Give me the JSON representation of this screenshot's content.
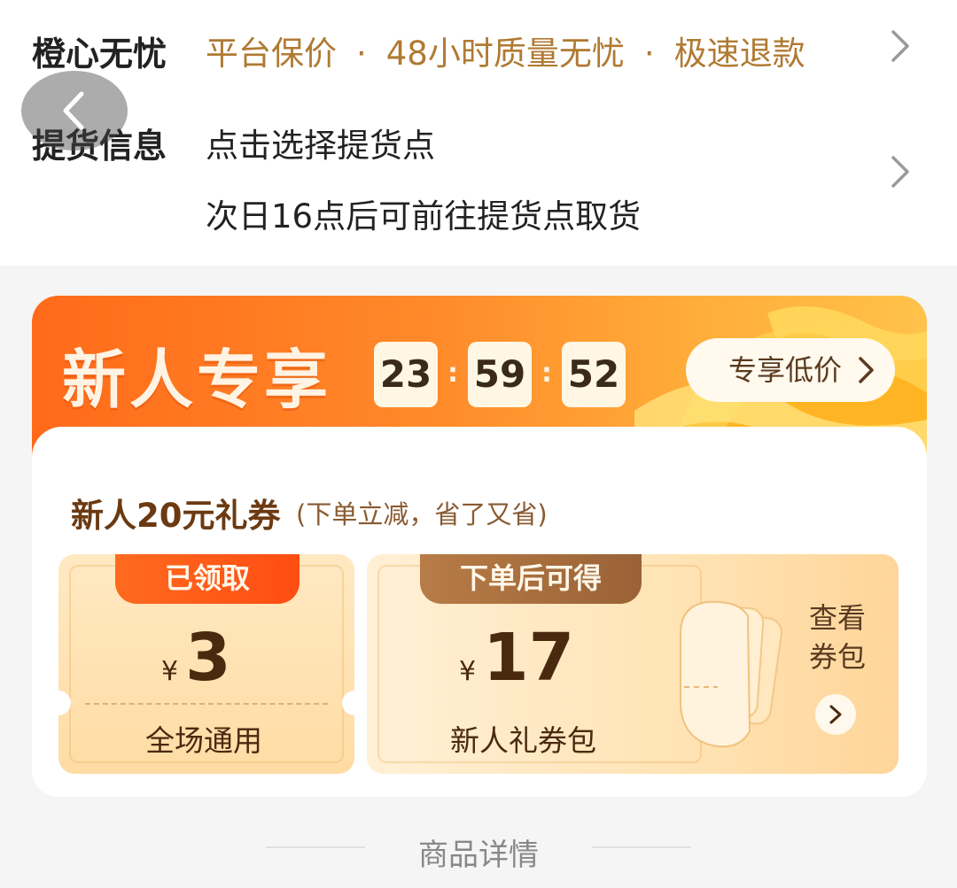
{
  "service": {
    "label": "橙心无忧",
    "items": [
      "平台保价",
      "48小时质量无忧",
      "极速退款"
    ],
    "separator": "·"
  },
  "pickup": {
    "label": "提货信息",
    "select_point": "点击选择提货点",
    "pickup_time": "次日16点后可前往提货点取货"
  },
  "promo": {
    "title": "新人专享",
    "countdown": {
      "hours": "23",
      "minutes": "59",
      "seconds": "52",
      "separator": ":"
    },
    "cta": "专享低价",
    "coupon_title": "新人20元礼券",
    "coupon_subtitle": "(下单立减，省了又省)",
    "tickets": [
      {
        "status": "已领取",
        "currency": "¥",
        "amount": "3",
        "label": "全场通用"
      },
      {
        "status": "下单后可得",
        "currency": "¥",
        "amount": "17",
        "label": "新人礼券包"
      }
    ],
    "view_wallet": "查看券包"
  },
  "detail_section": {
    "label": "商品详情"
  },
  "colors": {
    "accent_orange": "#ff6a1a",
    "gold_text": "#b07a33",
    "brown_text": "#4a2a0f"
  }
}
